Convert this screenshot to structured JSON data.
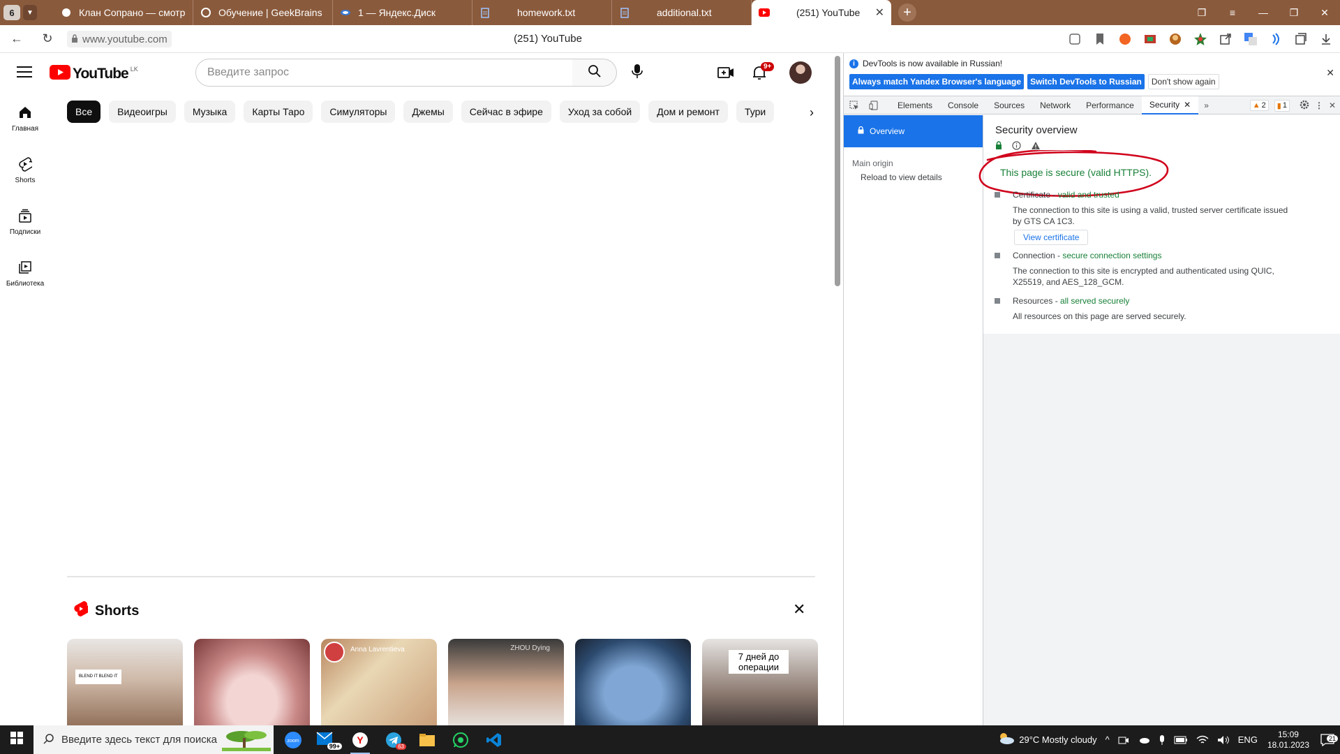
{
  "browser": {
    "tab_count": "6",
    "tabs": [
      {
        "title": "Клан Сопрано — смотреть"
      },
      {
        "title": "Обучение | GeekBrains - об"
      },
      {
        "title": "1 — Яндекс.Диск"
      },
      {
        "title": "homework.txt"
      },
      {
        "title": "additional.txt"
      },
      {
        "title": "(251) YouTube"
      }
    ],
    "url": "www.youtube.com",
    "page_title": "(251) YouTube"
  },
  "youtube": {
    "logo_text": "YouTube",
    "country_code": "LK",
    "search_placeholder": "Введите запрос",
    "notifications_badge": "9+",
    "guide": [
      {
        "label": "Главная"
      },
      {
        "label": "Shorts"
      },
      {
        "label": "Подписки"
      },
      {
        "label": "Библиотека"
      }
    ],
    "chips": [
      "Все",
      "Видеоигры",
      "Музыка",
      "Карты Таро",
      "Симуляторы",
      "Джемы",
      "Сейчас в эфире",
      "Уход за собой",
      "Дом и ремонт",
      "Тури"
    ],
    "shorts_title": "Shorts",
    "shorts_captions": {
      "t1": "BLEND IT BLEND IT",
      "t3_name": "Anna Lavrentieva",
      "t4": "ZHOU Dying",
      "t6": "7 дней до операции"
    }
  },
  "devtools": {
    "info_message": "DevTools is now available in Russian!",
    "btn_match": "Always match Yandex Browser's language",
    "btn_switch": "Switch DevTools to Russian",
    "btn_dont_show": "Don't show again",
    "tabs": [
      "Elements",
      "Console",
      "Sources",
      "Network",
      "Performance",
      "Security"
    ],
    "warnings_count": "2",
    "issues_count": "1",
    "nav": {
      "overview": "Overview",
      "main_origin": "Main origin",
      "reload": "Reload to view details"
    },
    "security": {
      "title": "Security overview",
      "secure_summary": "This page is secure (valid HTTPS).",
      "certificate_label": "Certificate - ",
      "certificate_status": "valid and trusted",
      "certificate_desc": "The connection to this site is using a valid, trusted server certificate issued by GTS CA 1C3.",
      "view_certificate": "View certificate",
      "connection_label": "Connection - ",
      "connection_status": "secure connection settings",
      "connection_desc": "The connection to this site is encrypted and authenticated using QUIC, X25519, and AES_128_GCM.",
      "resources_label": "Resources - ",
      "resources_status": "all served securely",
      "resources_desc": "All resources on this page are served securely."
    }
  },
  "taskbar": {
    "search_placeholder": "Введите здесь текст для поиска",
    "mail_badge": "99+",
    "telegram_badge": "63",
    "weather": "29°C  Mostly cloudy",
    "language": "ENG",
    "time": "15:09",
    "date": "18.01.2023",
    "notif_count": "21"
  },
  "colors": {
    "tabstrip": "#8a5a3c",
    "yt_red": "#ff0000",
    "devtools_blue": "#1a73e8",
    "secure_green": "#188038",
    "annotation_red": "#d0021b"
  }
}
